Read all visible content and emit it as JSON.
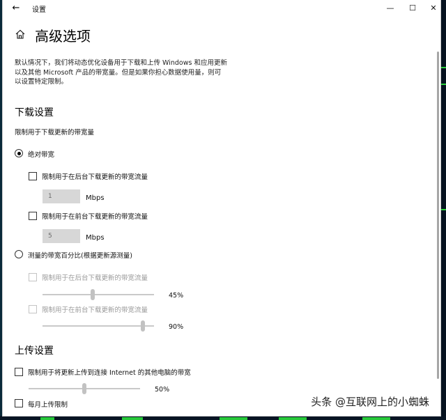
{
  "window": {
    "title": "设置",
    "controls": {
      "minimize": "—",
      "maximize": "☐",
      "close": "✕"
    }
  },
  "page": {
    "title": "高级选项",
    "description": "默认情况下，我们将动态优化设备用于下载和上传 Windows 和应用更新以及其他 Microsoft 产品的带宽量。但是如果你担心数据使用量，则可以设置特定限制。"
  },
  "download": {
    "section_title": "下载设置",
    "subtitle": "限制用于下载更新的带宽量",
    "absolute": {
      "label": "绝对带宽",
      "selected": true,
      "background": {
        "label": "限制用于在后台下载更新的带宽流量",
        "value": "1",
        "unit": "Mbps"
      },
      "foreground": {
        "label": "限制用于在前台下载更新的带宽流量",
        "value": "5",
        "unit": "Mbps"
      }
    },
    "percentage": {
      "label": "测量的带宽百分比(根据更新源测量)",
      "selected": false,
      "background": {
        "label": "限制用于在后台下载更新的带宽流量",
        "value": "45%",
        "level": 0.45
      },
      "foreground": {
        "label": "限制用于在前台下载更新的带宽流量",
        "value": "90%",
        "level": 0.9
      }
    }
  },
  "upload": {
    "section_title": "上传设置",
    "limit": {
      "label": "限制用于将更新上传到连接 Internet 的其他电脑的带宽",
      "value": "50%",
      "level": 0.5
    },
    "monthly": {
      "label": "每月上传限制"
    }
  },
  "watermark": "头条 @互联网上的小蜘蛛",
  "colors": {
    "desktop_green": "#2bd13b",
    "disabled_gray": "#c2c2c2"
  }
}
